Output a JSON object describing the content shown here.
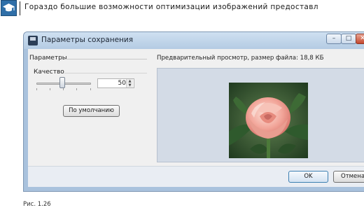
{
  "page": {
    "header_text": "Гораздо большие возможности оптимизации изображений предоставл",
    "caption": "Рис. 1.26"
  },
  "window": {
    "title": "Параметры сохранения",
    "controls": {
      "minimize": "–",
      "maximize": "□",
      "close": "✕"
    },
    "params_label": "Параметры",
    "quality_label": "Качество",
    "quality_value": "50",
    "quality_slider_fraction": 0.5,
    "default_button": "По умолчанию",
    "preview_label": "Предварительный просмотр, размер файла: 18,8 КБ",
    "ok_button": "OK",
    "cancel_button": "Отмена"
  },
  "icons": {
    "logo": "graduation-cap-icon",
    "title": "floppy-disk-icon",
    "spin_up": "arrow-up-icon",
    "spin_down": "arrow-down-icon"
  },
  "colors": {
    "title_bar": "#b4cbe3",
    "client_bg": "#f0f0f0",
    "preview_bg": "#d3dbe6",
    "close_button": "#c4472d",
    "logo": "#2f6fa8"
  }
}
